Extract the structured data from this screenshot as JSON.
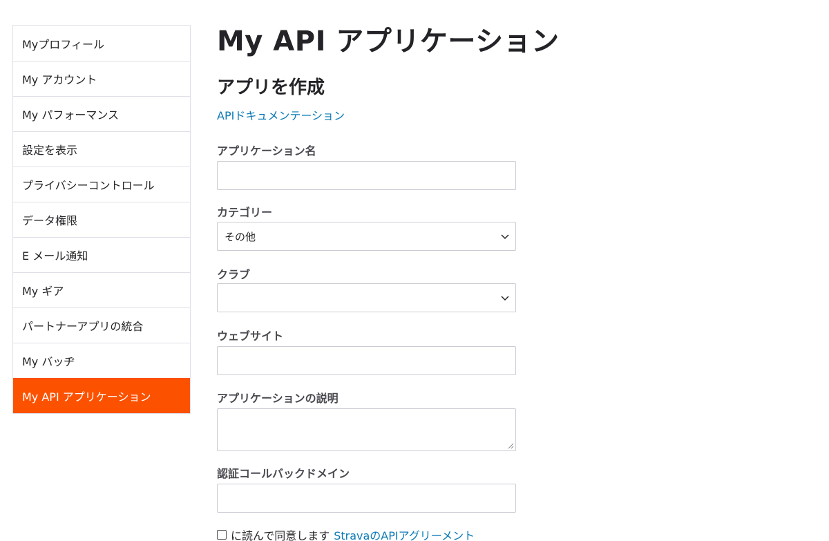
{
  "sidebar": {
    "items": [
      {
        "label": "Myプロフィール"
      },
      {
        "label": "My アカウント"
      },
      {
        "label": "My パフォーマンス"
      },
      {
        "label": "設定を表示"
      },
      {
        "label": "プライバシーコントロール"
      },
      {
        "label": "データ権限"
      },
      {
        "label": "E メール通知"
      },
      {
        "label": "My ギア"
      },
      {
        "label": "パートナーアプリの統合"
      },
      {
        "label": "My バッヂ"
      },
      {
        "label": "My API アプリケーション"
      }
    ],
    "active_index": 10,
    "active_color": "#fc5200"
  },
  "main": {
    "title": "My API アプリケーション",
    "section_title": "アプリを作成",
    "doc_link": "APIドキュメンテーション",
    "form": {
      "app_name_label": "アプリケーション名",
      "app_name_value": "",
      "category_label": "カテゴリー",
      "category_value": "その他",
      "club_label": "クラブ",
      "club_value": "",
      "website_label": "ウェブサイト",
      "website_value": "",
      "description_label": "アプリケーションの説明",
      "description_value": "",
      "callback_label": "認証コールバックドメイン",
      "callback_value": "",
      "agree_text": "に読んで同意します",
      "agree_link": "StravaのAPIアグリーメント",
      "agree_checked": false
    }
  },
  "colors": {
    "link": "#0a7ab5",
    "text": "#242428",
    "border": "#cbcbd4"
  },
  "icons": {
    "select_chevron": "chevron-down-icon",
    "textarea_resize": "resize-handle-icon"
  }
}
